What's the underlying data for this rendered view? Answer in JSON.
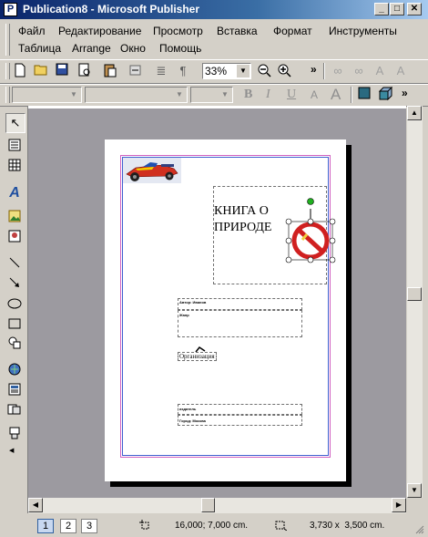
{
  "window": {
    "title": "Publication8 - Microsoft Publisher",
    "app_icon": "publisher-icon",
    "minimize": "_",
    "maximize": "□",
    "close": "✕"
  },
  "menu": {
    "row1": [
      "Файл",
      "Редактирование",
      "Просмотр",
      "Вставка",
      "Формат",
      "Инструменты"
    ],
    "row2": [
      "Таблица",
      "Arrange",
      "Окно",
      "Помощь"
    ]
  },
  "standard_toolbar": {
    "zoom_value": "33%",
    "overflow": "»",
    "icons": [
      "new-icon",
      "open-icon",
      "save-icon",
      "print-preview-icon",
      "paste-icon",
      "undo-icon",
      "columns-icon",
      "pilcrow-icon",
      "zoom-out-icon",
      "zoom-in-icon",
      "link-icon",
      "unlink-icon",
      "text-direction-icon",
      "font-size-icon"
    ]
  },
  "formatting_toolbar": {
    "bold": "B",
    "italic": "I",
    "underline": "U",
    "grow_font": "A",
    "shrink_font": "A",
    "overflow": "»"
  },
  "toolbox": [
    "pointer-icon",
    "text-box-icon",
    "table-icon",
    "wordart-icon",
    "picture-icon",
    "clipart-icon",
    "line-icon",
    "arrow-icon",
    "oval-icon",
    "rectangle-icon",
    "autoshapes-icon",
    "design-gallery-icon",
    "web-icon",
    "form-icon",
    "page-icon"
  ],
  "document": {
    "heading": "КНИГА О ПРИРОДЕ",
    "field1_label": "Автор: Иванов",
    "field2_label": "Жанр",
    "organization": "Организация",
    "footer1": "издатель",
    "footer2": "Город: Москва"
  },
  "status": {
    "pages": [
      "1",
      "2",
      "3"
    ],
    "active_page": "1",
    "position": "16,000; 7,000 cm.",
    "size": "3,730 x  3,500 cm."
  }
}
